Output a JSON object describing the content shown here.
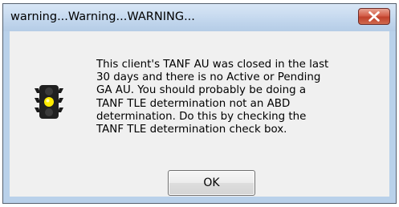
{
  "window": {
    "title": "warning...Warning...WARNING...",
    "close_icon": "close-icon",
    "close_color": "#c94a32"
  },
  "dialog": {
    "icon": "traffic-light-icon",
    "message": "This client's TANF AU was closed in the last\n30 days and there is no Active or Pending\nGA AU. You should probably be doing a\nTANF TLE determination not an ABD\ndetermination. Do this by checking the\nTANF TLE determination check  box.",
    "ok_label": "OK"
  }
}
